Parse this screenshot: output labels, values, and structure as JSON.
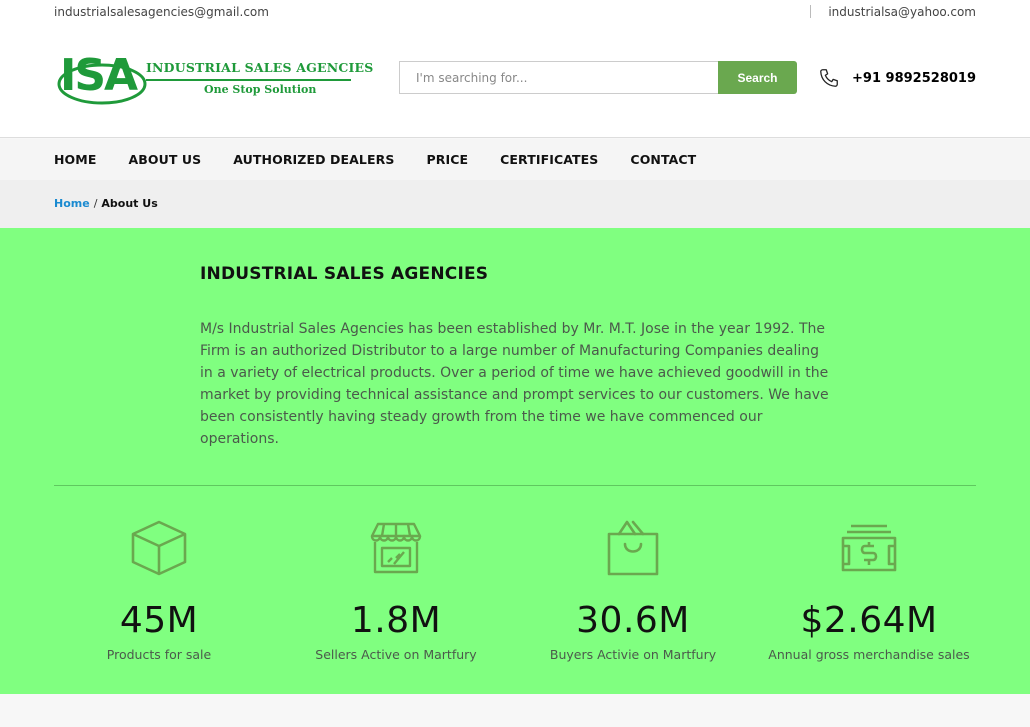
{
  "topbar": {
    "email_left": "industrialsalesagencies@gmail.com",
    "email_right": "industrialsa@yahoo.com"
  },
  "logo": {
    "mark": "ISA",
    "company": "INDUSTRIAL SALES AGENCIES",
    "tagline": "One Stop Solution"
  },
  "search": {
    "placeholder": "I'm searching for...",
    "button_label": "Search"
  },
  "phone": {
    "icon": "phone-icon",
    "number": "+91 9892528019"
  },
  "nav": {
    "items": [
      {
        "label": "HOME"
      },
      {
        "label": "ABOUT US"
      },
      {
        "label": "AUTHORIZED DEALERS"
      },
      {
        "label": "PRICE"
      },
      {
        "label": "CERTIFICATES"
      },
      {
        "label": "CONTACT"
      }
    ]
  },
  "breadcrumb": {
    "home": "Home",
    "separator": "/",
    "current": "About Us"
  },
  "about": {
    "title": "INDUSTRIAL SALES AGENCIES",
    "body": "M/s Industrial Sales Agencies has been established by Mr. M.T. Jose in the year 1992. The Firm is an authorized Distributor to a large number of Manufacturing Companies dealing in a variety of electrical products. Over a period of time we have achieved goodwill in the market by providing technical assistance and prompt services to our customers. We have been consistently having steady growth from the time we have commenced our operations.",
    "background": "#80ff80",
    "icon_color": "#6aa84f"
  },
  "stats": [
    {
      "icon": "box-icon",
      "value": "45M",
      "label": "Products for sale"
    },
    {
      "icon": "store-icon",
      "value": "1.8M",
      "label": "Sellers Active on Martfury"
    },
    {
      "icon": "shopping-bag-icon",
      "value": "30.6M",
      "label": "Buyers Activie on Martfury"
    },
    {
      "icon": "money-icon",
      "value": "$2.64M",
      "label": "Annual gross merchandise sales"
    }
  ],
  "colors": {
    "accent": "#6aa84f",
    "link": "#1a8ad0",
    "brand": "#1f9a3a"
  }
}
